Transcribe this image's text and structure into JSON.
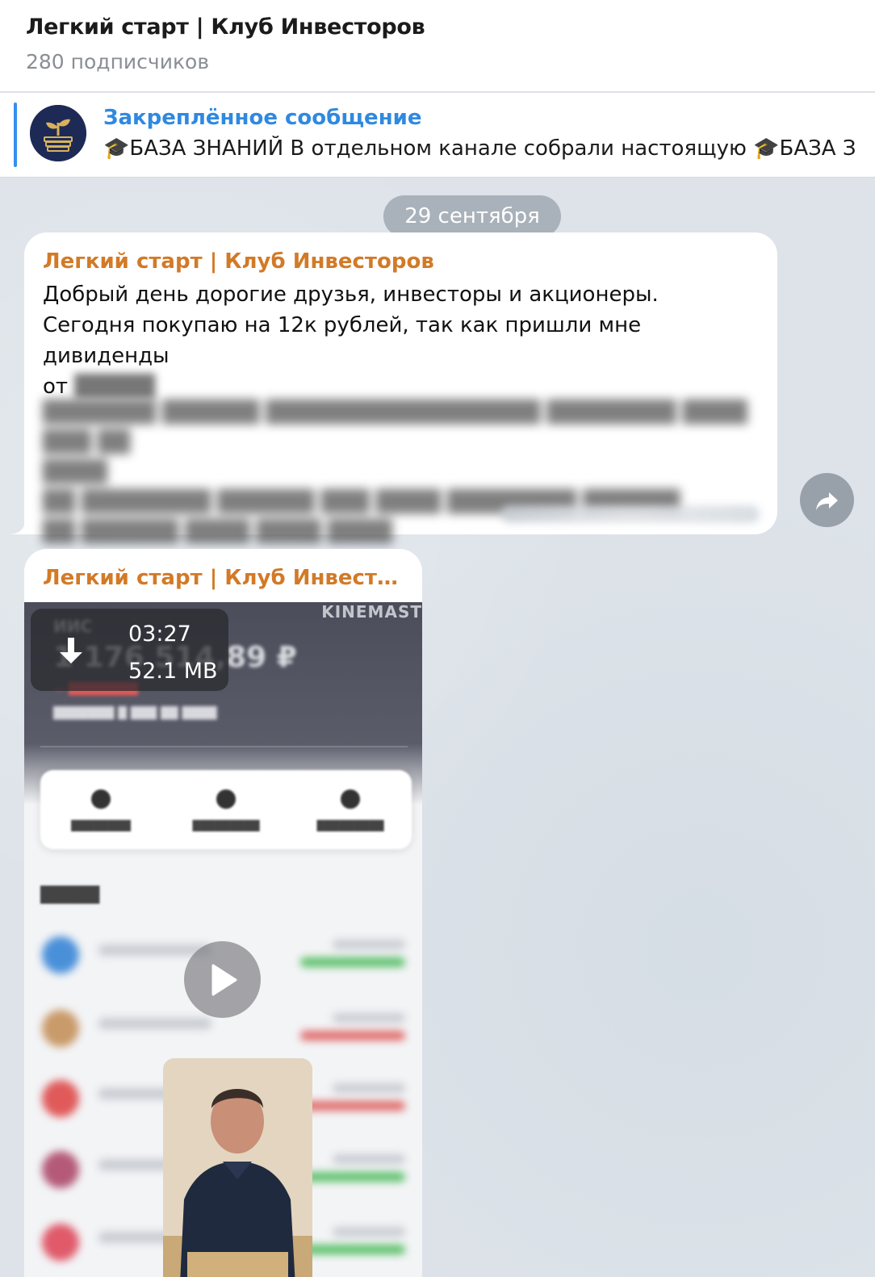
{
  "header": {
    "title": "Легкий старт | Клуб Инвесторов",
    "subtitle": "280 подписчиков"
  },
  "pinned": {
    "title": "Закреплённое сообщение",
    "text": "🎓БАЗА ЗНАНИЙ  В отдельном канале собрали настоящую 🎓БАЗА З",
    "logo_icon": "sprout-book-icon"
  },
  "chat": {
    "date": "29 сентября",
    "post1": {
      "sender": "Легкий старт | Клуб Инвесторов",
      "line1": "Добрый день дорогие друзья, инвесторы и акционеры.",
      "line2": "Сегодня покупаю на 12к рублей, так как пришли мне дивиденды",
      "line3_prefix": "от"
    },
    "share_icon": "share-arrow-icon",
    "post2": {
      "sender": "Легкий старт | Клуб Инвестор...",
      "video": {
        "duration": "03:27",
        "size": "52.1 MB",
        "watermark": "KINEMAST",
        "download_icon": "download-arrow-icon",
        "play_icon": "play-icon"
      }
    }
  },
  "colors": {
    "accent": "#3390ec",
    "sender": "#d27a27",
    "chat_bg": "#dde3e9"
  }
}
